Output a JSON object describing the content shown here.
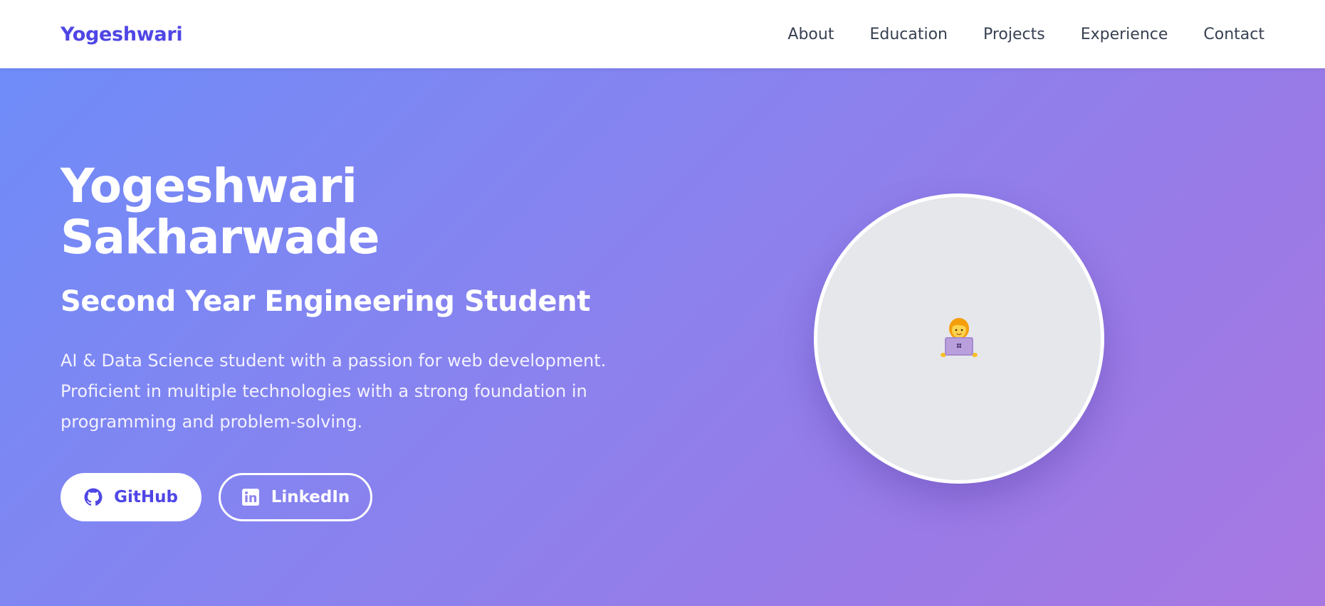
{
  "brand": {
    "name": "Yogeshwari",
    "color": "#4f46e5"
  },
  "nav": {
    "items": [
      {
        "label": "About"
      },
      {
        "label": "Education"
      },
      {
        "label": "Projects"
      },
      {
        "label": "Experience"
      },
      {
        "label": "Contact"
      }
    ]
  },
  "hero": {
    "name_line1": "Yogeshwari",
    "name_line2": "Sakharwade",
    "subtitle": "Second Year Engineering Student",
    "description_lines": [
      "AI & Data Science student with a passion for web development.",
      "Proficient in multiple technologies with a strong foundation in",
      "programming and problem-solving."
    ],
    "gradient_start": "#6f8cf8",
    "gradient_end": "#a878e2"
  },
  "buttons": {
    "github_label": "GitHub",
    "github_icon": "github-icon",
    "linkedin_label": "LinkedIn",
    "linkedin_icon": "linkedin-icon"
  },
  "profile": {
    "avatar_icon": "woman-technologist-icon",
    "circle_color": "#e5e7eb"
  }
}
